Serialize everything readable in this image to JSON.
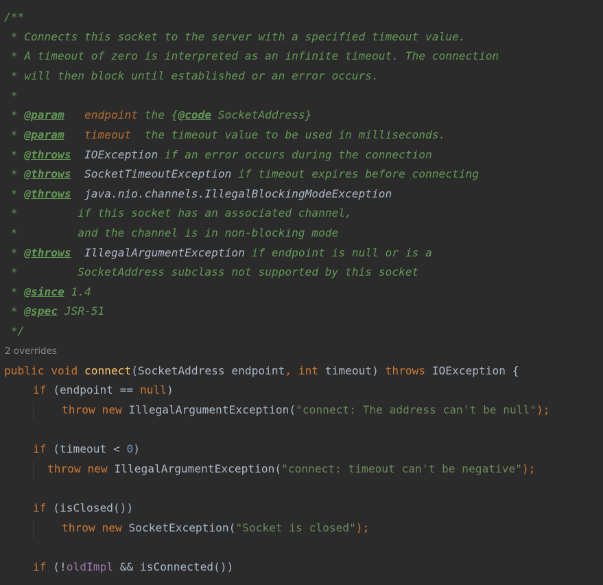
{
  "javadoc": {
    "open": "/**",
    "line1": " * Connects this socket to the server with a specified timeout value.",
    "line2": " * A timeout of zero is interpreted as an infinite timeout. The connection",
    "line3": " * will then block until established or an error occurs.",
    "line4": " *",
    "star": " * ",
    "param_tag": "@param",
    "param1_pad": "   ",
    "param1_name": "endpoint",
    "param1_text_a": " the {",
    "code_tag": "@code",
    "param1_text_b": " SocketAddress}",
    "param2_name": "timeout",
    "param2_text": "  the timeout value to be used in milliseconds.",
    "throws_tag": "@throws",
    "throws_pad": "  ",
    "throws1_type": "IOException",
    "throws1_text": " if an error occurs during the connection",
    "throws2_type": "SocketTimeoutException",
    "throws2_text": " if timeout expires before connecting",
    "throws3_type": "java.nio.channels.IllegalBlockingModeException",
    "cont1": " *         if this socket has an associated channel,",
    "cont2": " *         and the channel is in non-blocking mode",
    "throws4_type": "IllegalArgumentException",
    "throws4_text": " if endpoint is null or is a",
    "cont3": " *         SocketAddress subclass not supported by this socket",
    "since_tag": "@since",
    "since_text": " 1.4",
    "spec_tag": "@spec",
    "spec_text": " JSR-51",
    "close": " */"
  },
  "hint": {
    "overrides": "2 overrides"
  },
  "code": {
    "kw_public": "public",
    "kw_void": "void",
    "kw_int": "int",
    "kw_throws": "throws",
    "kw_if": "if",
    "kw_throw": "throw",
    "kw_new": "new",
    "kw_null": "null",
    "method_name": "connect",
    "sig_a": "(SocketAddress endpoint",
    "comma": ",",
    "sig_b": " timeout) ",
    "sig_c": " IOException {",
    "if1_cond_a": " (endpoint == ",
    "close_paren": ")",
    "iae": " IllegalArgumentException(",
    "str_null": "\"connect: The address can't be null\"",
    "stmt_end": ");",
    "if2_cond": " (timeout < ",
    "zero": "0",
    "str_neg": "\"connect: timeout can't be negative\"",
    "if3_cond": " (isClosed())",
    "se": " SocketException(",
    "str_closed": "\"Socket is closed\"",
    "if4_a": " (!",
    "old_impl": "oldImpl",
    "if4_b": " && isConnected())"
  },
  "colors": {
    "background": "#2b2b2b",
    "keyword": "#cc7832",
    "doc_comment": "#629755",
    "string": "#6a8759",
    "method": "#ffc66d",
    "number": "#6897bb",
    "field": "#9876aa",
    "text": "#a9b7c6"
  }
}
